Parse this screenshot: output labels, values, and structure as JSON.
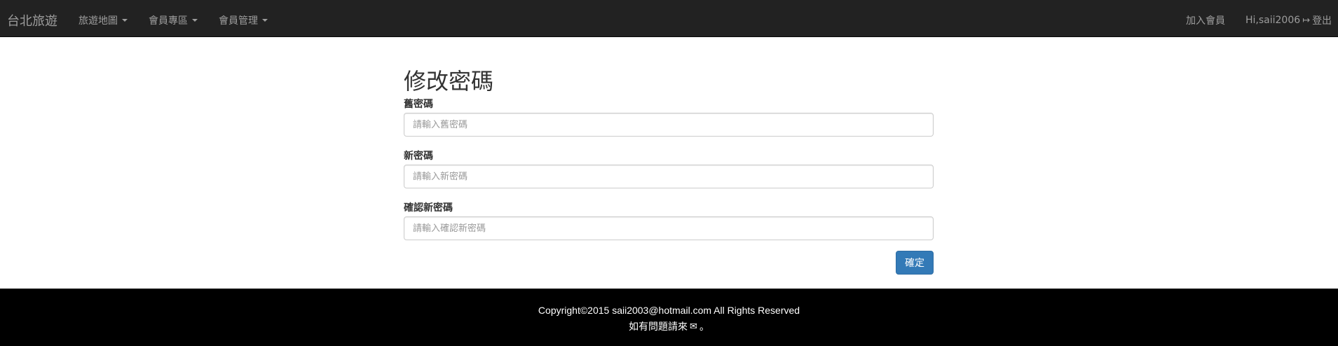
{
  "navbar": {
    "brand": "台北旅遊",
    "menus": [
      {
        "label": "旅遊地圖"
      },
      {
        "label": "會員專區"
      },
      {
        "label": "會員管理"
      }
    ],
    "join_label": "加入會員",
    "greeting": "Hi,saii2006",
    "logout_icon": "logout-icon",
    "logout_label": "登出"
  },
  "form": {
    "title": "修改密碼",
    "old_password": {
      "label": "舊密碼",
      "placeholder": "請輸入舊密碼",
      "value": ""
    },
    "new_password": {
      "label": "新密碼",
      "placeholder": "請輸入新密碼",
      "value": ""
    },
    "confirm_password": {
      "label": "確認新密碼",
      "placeholder": "請輸入確認新密碼",
      "value": ""
    },
    "submit_label": "確定"
  },
  "footer": {
    "copyright": "Copyright©2015 saii2003@hotmail.com All Rights Reserved",
    "contact_prefix": "如有問題請來",
    "contact_icon": "mail-icon",
    "contact_suffix": "。"
  },
  "colors": {
    "navbar_bg": "#222222",
    "footer_bg": "#000000",
    "primary": "#337ab7"
  }
}
